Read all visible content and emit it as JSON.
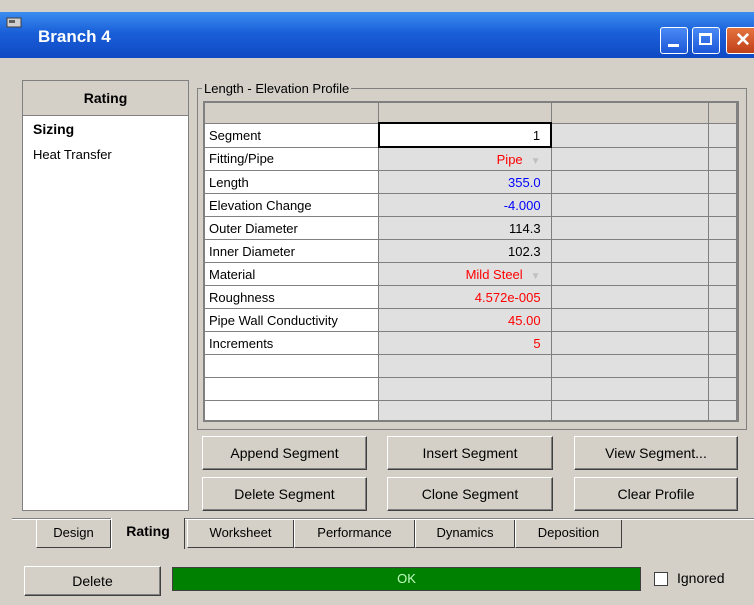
{
  "window": {
    "title": "Branch 4"
  },
  "sidebar": {
    "header": "Rating",
    "items": [
      {
        "label": "Sizing",
        "active": true
      },
      {
        "label": "Heat Transfer",
        "active": false
      }
    ]
  },
  "group": {
    "label": "Length - Elevation Profile"
  },
  "grid": {
    "rows": [
      {
        "label": "Segment",
        "value": "1",
        "color": "#000000"
      },
      {
        "label": "Fitting/Pipe",
        "value": "Pipe",
        "color": "#ff0000",
        "dropdown": true
      },
      {
        "label": "Length",
        "value": "355.0",
        "color": "#0000ff"
      },
      {
        "label": "Elevation Change",
        "value": "-4.000",
        "color": "#0000ff"
      },
      {
        "label": "Outer Diameter",
        "value": "114.3",
        "color": "#000000"
      },
      {
        "label": "Inner Diameter",
        "value": "102.3",
        "color": "#000000"
      },
      {
        "label": "Material",
        "value": "Mild Steel",
        "color": "#ff0000",
        "dropdown": true
      },
      {
        "label": "Roughness",
        "value": "4.572e-005",
        "color": "#ff0000"
      },
      {
        "label": "Pipe Wall Conductivity",
        "value": "45.00",
        "color": "#ff0000"
      },
      {
        "label": "Increments",
        "value": "5",
        "color": "#ff0000"
      }
    ]
  },
  "buttons": {
    "append": "Append Segment",
    "insert": "Insert Segment",
    "view": "View Segment...",
    "delete_segment": "Delete Segment",
    "clone": "Clone Segment",
    "clear": "Clear Profile"
  },
  "tabs": [
    "Design",
    "Rating",
    "Worksheet",
    "Performance",
    "Dynamics",
    "Deposition"
  ],
  "active_tab": "Rating",
  "footer": {
    "delete": "Delete",
    "status": "OK",
    "ignored_label": "Ignored",
    "ignored_checked": false
  },
  "colors": {
    "status_ok": "#008000",
    "title_bar": "#1a5fd8",
    "required_value": "#ff0000",
    "user_value": "#0000ff"
  }
}
